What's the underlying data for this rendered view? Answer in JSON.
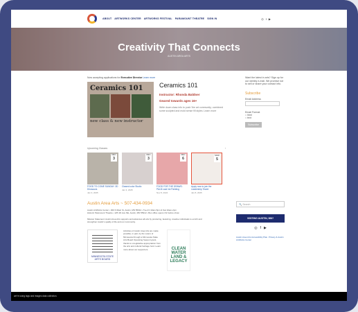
{
  "nav": {
    "items": [
      "ABOUT",
      "ARTWORKS CENTER",
      "ARTWORKS FESTIVAL",
      "PARAMOUNT THEATRE",
      "SIGN IN"
    ],
    "social": [
      "◎",
      "f",
      "▶"
    ]
  },
  "hero": {
    "title": "Creativity That Connects",
    "subtitle": "AUSTIN AREA ARTS"
  },
  "notice": {
    "text": "Now accepting applications for ",
    "bold": "Executive Director",
    "link": "Learn more"
  },
  "feature": {
    "image_title": "Ceramics 101",
    "image_caption": "new class & new instructor",
    "title": "Ceramics 101",
    "instructor": "Instructor: Rhonda Baldner",
    "ages": "Geared towards ages 16+",
    "desc": "Write down class info to push 'the art community; combined some sculpted and mold sense fill styles. Learn more"
  },
  "upcoming": {
    "label": "Upcoming Classes",
    "arrow": "›"
  },
  "events": [
    {
      "day": "3",
      "month": "DEC",
      "title": "FOOD TO COME SUNDAY: 3D Dinosaurs",
      "when": "Jan 3, 2025",
      "color": "#b9b3a9"
    },
    {
      "day": "3",
      "month": "DEC",
      "title": "Clawed color Studio",
      "when": "Jan 3, 2025",
      "color": "#d7d0cf"
    },
    {
      "day": "6",
      "month": "DEC",
      "title": "FOOD FOR THE DRAWS: PALM cast Ink Painting",
      "when": "Nov 8, 2024",
      "color": "#e7a7a9"
    },
    {
      "day": "5",
      "month": "MAR",
      "title": "Apply now to join the Leadership Team!",
      "when": "Jan 8, 2025",
      "color": "#f2ede9"
    }
  ],
  "footer": {
    "org": "Austin Area Arts ~ 507-434-0934",
    "addr1": "Austin ArtWorks Center • 300 N Main St, Austin, MN 55912 • Tue-Fri 10am-5pm & Sat 10am-2pm",
    "addr2": "Historic Paramount Theatre • 125 4th Ave NE, Austin, MN 55912 • Box office opens 1hr before show",
    "mission": "Mission Statement: Austin Area Arts supports and advances all arts by producing, featuring, creative individuals to enrich and strengthen Austin's quality of life and our community.",
    "grant": "Activities of Austin Area Arts are made possible, in part, by the voters of Minnesota through a Minnesota State Arts Board Operating Support grant, thanks to a legislative appropriation from the arts and cultural heritage fund. Learn more about our supporters.",
    "msab": "MINNESOTA STATE ARTS BOARD",
    "legacy": "CLEAN WATER LAND & LEGACY",
    "search_placeholder": "Search",
    "visit_button": "VISITING AUSTIN, MN?",
    "social": [
      "◎",
      "f",
      "▶"
    ],
    "links": "Austin Area Arts Accessibility Plan. Privacy & Austin ArtWorks Center"
  },
  "sidebar": {
    "intro": "Want the latest in arts? Sign up for our weekly e-mail. We promise not to sell or share your contact info.",
    "heading": "Subscribe",
    "email_label": "Email Address",
    "format_label": "Email Format",
    "fmt1": "html",
    "fmt2": "text",
    "button": "Subscribe"
  },
  "bottombar": "we're using tags and images data collection."
}
